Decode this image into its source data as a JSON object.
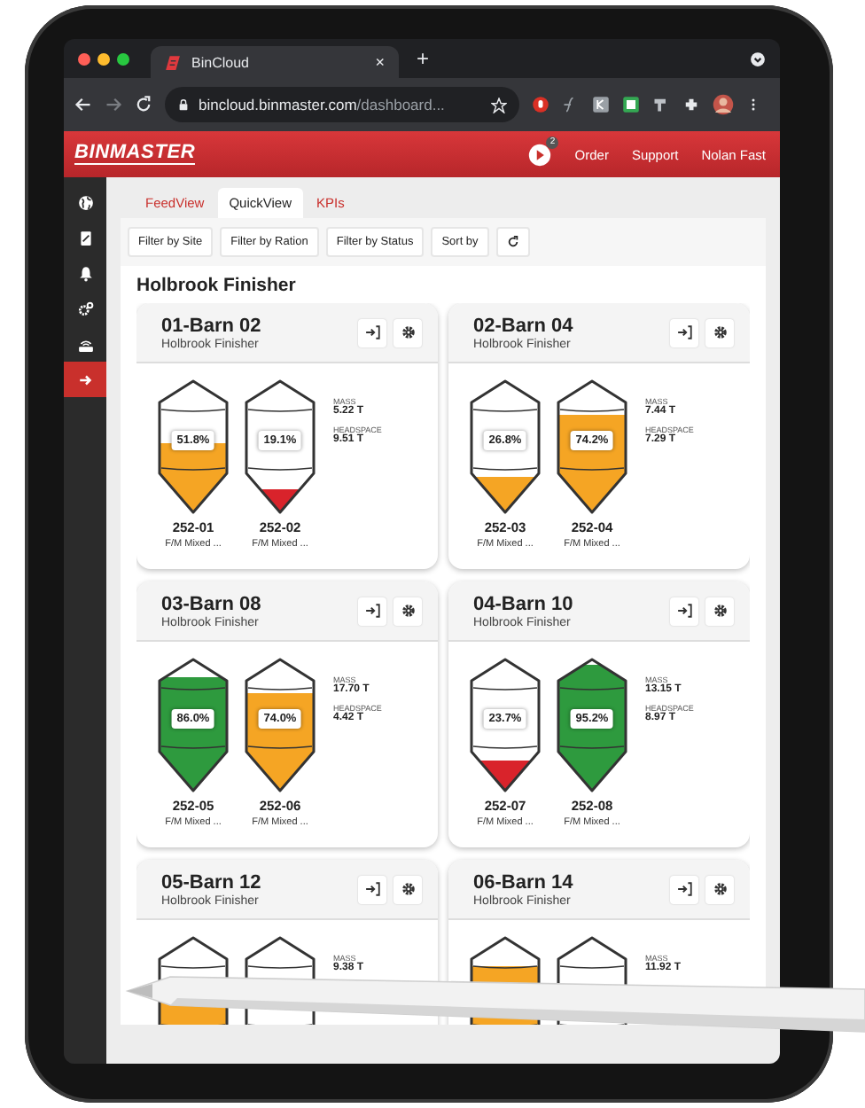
{
  "browser": {
    "tab_title": "BinCloud",
    "tab_close": "×",
    "new_tab": "+",
    "url_host": "bincloud.binmaster.com",
    "url_path": "/dashboard..."
  },
  "header": {
    "logo": "BINMASTER",
    "notification_count": "2",
    "links": [
      "Order",
      "Support",
      "Nolan Fast"
    ]
  },
  "sidebar": {
    "items": [
      {
        "selected": false
      },
      {
        "selected": false
      },
      {
        "selected": false
      },
      {
        "selected": false
      },
      {
        "selected": false
      },
      {
        "selected": true
      }
    ]
  },
  "tabs": [
    {
      "label": "FeedView",
      "selected": false
    },
    {
      "label": "QuickView",
      "selected": true
    },
    {
      "label": "KPIs",
      "selected": false
    }
  ],
  "filters": [
    "Filter by Site",
    "Filter by Ration",
    "Filter by Status",
    "Sort by"
  ],
  "site_title": "Holbrook Finisher",
  "cards": [
    {
      "title": "01-Barn 02",
      "subtitle": "Holbrook Finisher",
      "mass_label": "MASS",
      "mass": "5.22 T",
      "headspace_label": "HEADSPACE",
      "headspace": "9.51 T",
      "bins": [
        {
          "kind": "silo",
          "percent": "51.8%",
          "level": 0.52,
          "color": "#f5a524",
          "id": "252-01",
          "ration": "F/M Mixed ..."
        },
        {
          "kind": "silo",
          "percent": "19.1%",
          "level": 0.19,
          "color": "#d9232b",
          "id": "252-02",
          "ration": "F/M Mixed ..."
        }
      ]
    },
    {
      "title": "02-Barn 04",
      "subtitle": "Holbrook Finisher",
      "mass_label": "MASS",
      "mass": "7.44 T",
      "headspace_label": "HEADSPACE",
      "headspace": "7.29 T",
      "bins": [
        {
          "kind": "silo",
          "percent": "26.8%",
          "level": 0.27,
          "color": "#f5a524",
          "id": "252-03",
          "ration": "F/M Mixed ..."
        },
        {
          "kind": "silo",
          "percent": "74.2%",
          "level": 0.74,
          "color": "#f5a524",
          "id": "252-04",
          "ration": "F/M Mixed ..."
        }
      ]
    },
    {
      "title": "03-Barn 08",
      "subtitle": "Holbrook Finisher",
      "mass_label": "MASS",
      "mass": "17.70 T",
      "headspace_label": "HEADSPACE",
      "headspace": "4.42 T",
      "bins": [
        {
          "kind": "silo",
          "percent": "86.0%",
          "level": 0.86,
          "color": "#2e9a3e",
          "id": "252-05",
          "ration": "F/M Mixed ..."
        },
        {
          "kind": "silo",
          "percent": "74.0%",
          "level": 0.74,
          "color": "#f5a524",
          "id": "252-06",
          "ration": "F/M Mixed ..."
        }
      ]
    },
    {
      "title": "04-Barn 10",
      "subtitle": "Holbrook Finisher",
      "mass_label": "MASS",
      "mass": "13.15 T",
      "headspace_label": "HEADSPACE",
      "headspace": "8.97 T",
      "bins": [
        {
          "kind": "silo",
          "percent": "23.7%",
          "level": 0.24,
          "color": "#d9232b",
          "id": "252-07",
          "ration": "F/M Mixed ..."
        },
        {
          "kind": "silo",
          "percent": "95.2%",
          "level": 0.95,
          "color": "#2e9a3e",
          "id": "252-08",
          "ration": "F/M Mixed ..."
        }
      ]
    },
    {
      "title": "05-Barn 12",
      "subtitle": "Holbrook Finisher",
      "mass_label": "MASS",
      "mass": "9.38 T",
      "bins": [
        {
          "kind": "silo",
          "level": 0.62,
          "color": "#f5a524"
        },
        {
          "kind": "silo"
        }
      ]
    },
    {
      "title": "06-Barn 14",
      "subtitle": "Holbrook Finisher",
      "mass_label": "MASS",
      "mass": "11.92 T",
      "bins": [
        {
          "kind": "silo",
          "level": 0.78,
          "color": "#f5a524"
        },
        {
          "kind": "silo"
        }
      ]
    }
  ]
}
